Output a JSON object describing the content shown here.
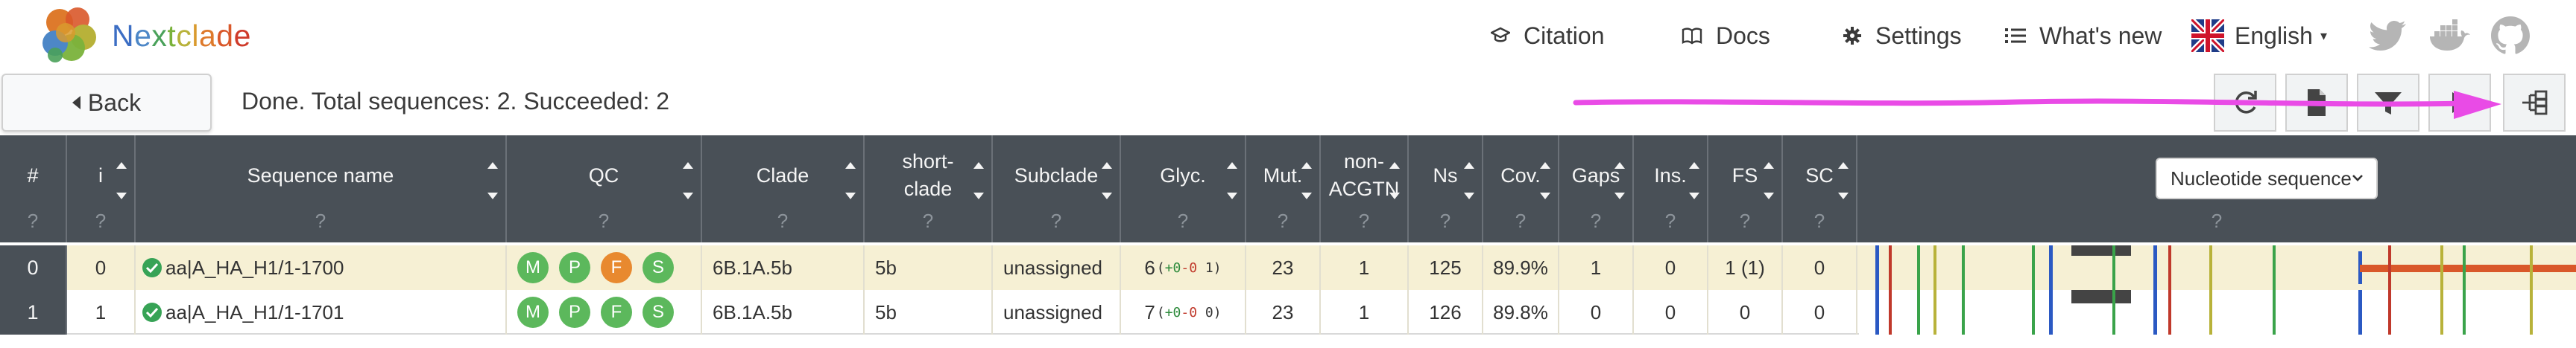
{
  "brand": {
    "name_letters": [
      "N",
      "e",
      "x",
      "t",
      "c",
      "l",
      "a",
      "d",
      "e"
    ],
    "letter_colors": [
      "#3c6ec4",
      "#4d87c7",
      "#4aa15a",
      "#7ab23b",
      "#b8b23a",
      "#d99a2e",
      "#de7a2c",
      "#d9582a",
      "#cf3b2b"
    ]
  },
  "nav": {
    "citation": "Citation",
    "docs": "Docs",
    "settings": "Settings",
    "whats_new": "What's new",
    "language": "English"
  },
  "toolbar": {
    "back": "Back",
    "status": "Done. Total sequences: 2. Succeeded: 2"
  },
  "columns": {
    "idx": "#",
    "i": "i",
    "name": "Sequence name",
    "qc": "QC",
    "clade": "Clade",
    "short_clade": "short-\nclade",
    "subclade": "Subclade",
    "glyc": "Glyc.",
    "mut": "Mut.",
    "nonacgtn": "non-\nACGTN",
    "ns": "Ns",
    "cov": "Cov.",
    "gaps": "Gaps",
    "ins": "Ins.",
    "fs": "FS",
    "sc": "SC",
    "qm": "?"
  },
  "sequence_view": {
    "selected": "Nucleotide sequence"
  },
  "rows": [
    {
      "idx": "0",
      "i": "0",
      "name": "aa|A_HA_H1/1-1700",
      "qc": [
        {
          "letter": "M",
          "color": "#5cb85c"
        },
        {
          "letter": "P",
          "color": "#5cb85c"
        },
        {
          "letter": "F",
          "color": "#e8892f"
        },
        {
          "letter": "S",
          "color": "#5cb85c"
        }
      ],
      "clade": "6B.1A.5b",
      "short_clade": "5b",
      "subclade": "unassigned",
      "glyc": "6",
      "glyc_plus": "+0",
      "glyc_minus": "-0",
      "glyc_tail": "1",
      "mut": "23",
      "nonacgtn": "1",
      "ns": "125",
      "cov": "89.9%",
      "gaps": "1",
      "ins": "0",
      "fs": "1 (1)",
      "sc": "0"
    },
    {
      "idx": "1",
      "i": "1",
      "name": "aa|A_HA_H1/1-1701",
      "qc": [
        {
          "letter": "M",
          "color": "#5cb85c"
        },
        {
          "letter": "P",
          "color": "#5cb85c"
        },
        {
          "letter": "F",
          "color": "#5cb85c"
        },
        {
          "letter": "S",
          "color": "#5cb85c"
        }
      ],
      "clade": "6B.1A.5b",
      "short_clade": "5b",
      "subclade": "unassigned",
      "glyc": "7",
      "glyc_plus": "+0",
      "glyc_minus": "-0",
      "glyc_tail": "0",
      "mut": "23",
      "nonacgtn": "1",
      "ns": "126",
      "cov": "89.8%",
      "gaps": "0",
      "ins": "0",
      "fs": "0",
      "sc": "0"
    }
  ],
  "colors": {
    "header_bg": "#495057",
    "highlight_row": "#f6f0d4",
    "annotation_arrow": "#e94be6"
  }
}
